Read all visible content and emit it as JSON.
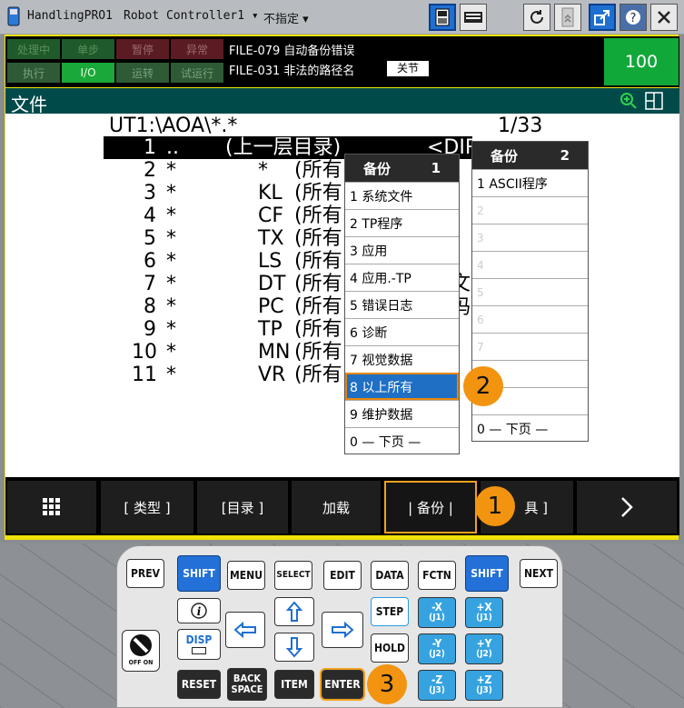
{
  "titlebar": {
    "app": "HandlingPRO1",
    "controller": "Robot Controller1",
    "unspecified": "不指定"
  },
  "status_leds": [
    {
      "label": "处理中"
    },
    {
      "label": "单步"
    },
    {
      "label": "暂停"
    },
    {
      "label": "异常"
    },
    {
      "label": "执行"
    },
    {
      "label": "I/O"
    },
    {
      "label": "运转"
    },
    {
      "label": "试运行"
    }
  ],
  "alarms": [
    "FILE-079 自动备份错误",
    "FILE-031 非法的路径名"
  ],
  "alarm_close": "关节",
  "override": "100",
  "header": {
    "title": "文件"
  },
  "content": {
    "path": "UT1:\\AOA\\*.*",
    "page": "1/33",
    "rows": [
      {
        "num": "1",
        "name": "..",
        "desc": "(上一层目录)",
        "tail": "<DIR"
      },
      {
        "num": "2",
        "name": "*",
        "ext": "*",
        "desc": "(所有"
      },
      {
        "num": "3",
        "name": "*",
        "ext": "KL",
        "desc": "(所有"
      },
      {
        "num": "4",
        "name": "*",
        "ext": "CF",
        "desc": "(所有"
      },
      {
        "num": "5",
        "name": "*",
        "ext": "TX",
        "desc": "(所有"
      },
      {
        "num": "6",
        "name": "*",
        "ext": "LS",
        "desc": "(所有"
      },
      {
        "num": "7",
        "name": "*",
        "ext": "DT",
        "desc": "(所有"
      },
      {
        "num": "8",
        "name": "*",
        "ext": "PC",
        "desc": "(所有"
      },
      {
        "num": "9",
        "name": "*",
        "ext": "TP",
        "desc": "(所有"
      },
      {
        "num": "10",
        "name": "*",
        "ext": "MN",
        "desc": "(所有"
      },
      {
        "num": "11",
        "name": "*",
        "ext": "VR",
        "desc": "(所有"
      }
    ],
    "peek1": "文",
    "peek2": "吗"
  },
  "popup1": {
    "title": "备份",
    "page": "1",
    "items": [
      "1 系统文件",
      "2 TP程序",
      "3 应用",
      "4 应用.-TP",
      "5 错误日志",
      "6 诊断",
      "7 视觉数据",
      "8 以上所有",
      "9 维护数据",
      "0 — 下页 —"
    ]
  },
  "popup2": {
    "title": "备份",
    "page": "2",
    "items": [
      "1 ASCII程序",
      "2",
      "3",
      "4",
      "5",
      "6",
      "7",
      "",
      "",
      "0 — 下页 —"
    ]
  },
  "fkeys": {
    "f1": "[ 类型 ]",
    "f2": "[目录 ]",
    "f3": "加载",
    "f4": "| 备份 |",
    "f5": "具 ]"
  },
  "callouts": [
    "1",
    "2",
    "3"
  ],
  "pendant": {
    "prev": "PREV",
    "shift": "SHIFT",
    "menu": "MENU",
    "select": "SELECT",
    "edit": "EDIT",
    "data": "DATA",
    "fctn": "FCTN",
    "next": "NEXT",
    "disp": "DISP",
    "step": "STEP",
    "hold": "HOLD",
    "reset": "RESET",
    "back1": "BACK",
    "back2": "SPACE",
    "item": "ITEM",
    "enter": "ENTER",
    "off_on": "OFF ON",
    "jog": [
      {
        "sign": "-X",
        "j": "(J1)"
      },
      {
        "sign": "+X",
        "j": "(J1)"
      },
      {
        "sign": "-Y",
        "j": "(J2)"
      },
      {
        "sign": "+Y",
        "j": "(J2)"
      },
      {
        "sign": "-Z",
        "j": "(J3)"
      },
      {
        "sign": "+Z",
        "j": "(J3)"
      }
    ]
  }
}
